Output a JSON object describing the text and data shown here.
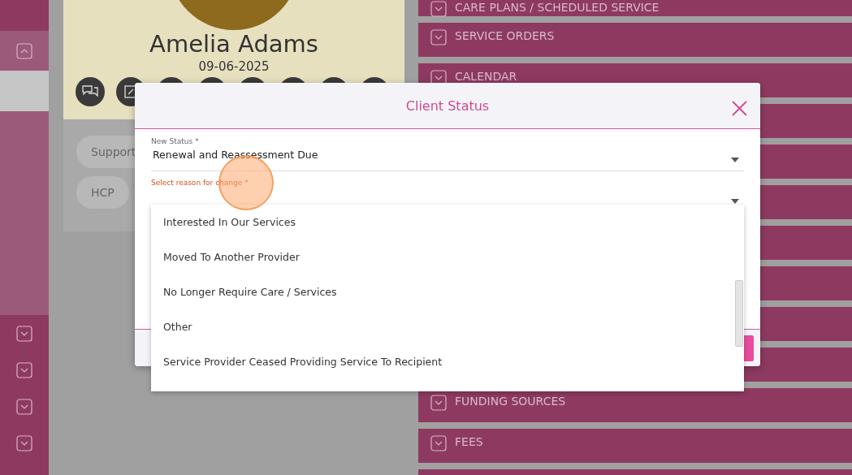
{
  "sidebar": {
    "sections": [
      {
        "expanded": true
      },
      {
        "expanded": false
      },
      {
        "expanded": false
      },
      {
        "expanded": false
      },
      {
        "expanded": false
      }
    ]
  },
  "profile": {
    "name": "Amelia Adams",
    "date": "09-06-2025",
    "tags": [
      "Support",
      "HCP"
    ]
  },
  "sections": [
    {
      "title": "CARE PLANS / SCHEDULED SERVICE",
      "expanded": false
    },
    {
      "title": "SERVICE ORDERS",
      "expanded": false
    },
    {
      "title": "CALENDAR",
      "expanded": false
    },
    {
      "title": "FUNDING SOURCES",
      "expanded": false
    },
    {
      "title": "FEES",
      "expanded": false
    }
  ],
  "dialog": {
    "title": "Client Status",
    "fields": [
      {
        "label": "New Status *",
        "value": "Renewal and Reassessment Due",
        "focused": false
      },
      {
        "label": "Select reason for change *",
        "focused": true
      }
    ],
    "options": [
      "Interested In Our Services",
      "Moved To Another Provider",
      "No Longer Require Care / Services",
      "Other",
      "Service Provider Ceased Providing Service To Recipient"
    ]
  }
}
